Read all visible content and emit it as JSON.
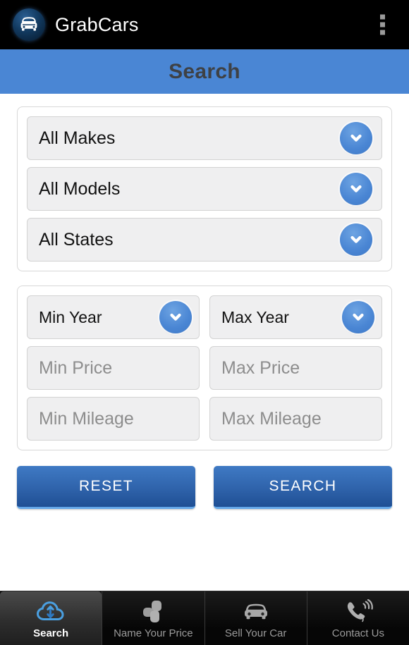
{
  "appbar": {
    "title": "GrabCars",
    "logo_icon": "car-front-icon",
    "overflow_icon": "overflow-menu-icon"
  },
  "header": {
    "title": "Search",
    "bar_color": "#4a86d4",
    "title_color": "#3e4145"
  },
  "filters_card": {
    "rows": [
      {
        "label": "All Makes",
        "icon": "chevron-down-icon",
        "type": "spinner"
      },
      {
        "label": "All Models",
        "icon": "chevron-down-icon",
        "type": "spinner"
      },
      {
        "label": "All States",
        "icon": "chevron-down-icon",
        "type": "spinner"
      }
    ]
  },
  "range_card": {
    "min_year": {
      "label": "Min Year",
      "icon": "chevron-down-icon",
      "type": "spinner"
    },
    "max_year": {
      "label": "Max Year",
      "icon": "chevron-down-icon",
      "type": "spinner"
    },
    "min_price": {
      "placeholder": "Min Price",
      "value": "",
      "type": "input"
    },
    "max_price": {
      "placeholder": "Max Price",
      "value": "",
      "type": "input"
    },
    "min_mileage": {
      "placeholder": "Min Mileage",
      "value": "",
      "type": "input"
    },
    "max_mileage": {
      "placeholder": "Max Mileage",
      "value": "",
      "type": "input"
    }
  },
  "actions": {
    "reset_label": "RESET",
    "search_label": "SEARCH",
    "button_color": "#2f63ab",
    "button_accent": "#63a6e8"
  },
  "tabbar": {
    "tabs": [
      {
        "label": "Search",
        "icon": "cloud-sync-icon",
        "active": true
      },
      {
        "label": "Name Your Price",
        "icon": "puzzle-piece-icon",
        "active": false
      },
      {
        "label": "Sell Your Car",
        "icon": "car-icon",
        "active": false
      },
      {
        "label": "Contact Us",
        "icon": "phone-ringing-icon",
        "active": false
      }
    ],
    "active_color": "#ffffff",
    "inactive_color": "#9b9b9b",
    "accent_color": "#4a9fe0"
  }
}
